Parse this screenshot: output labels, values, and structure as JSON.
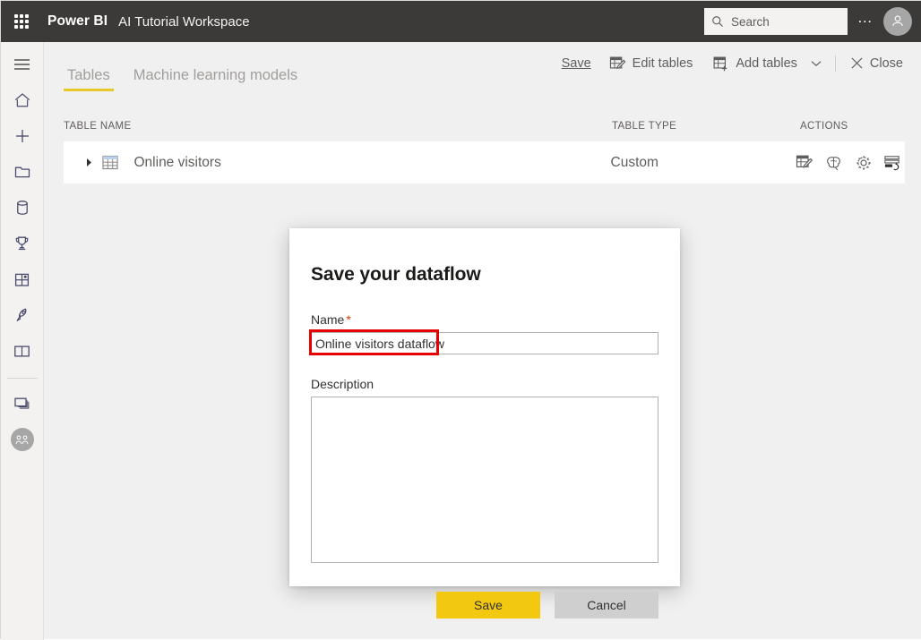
{
  "topbar": {
    "waffle_icon": "app-launcher-icon",
    "brand": "Power BI",
    "workspace": "AI Tutorial Workspace",
    "search": {
      "icon": "search-icon",
      "placeholder": "Search",
      "value": ""
    },
    "ellipsis": "…",
    "avatar_icon": "user-avatar-icon"
  },
  "rail": {
    "items": [
      {
        "icon": "hamburger-menu-icon",
        "name": "navigation-toggle"
      },
      {
        "icon": "home-icon",
        "name": "home"
      },
      {
        "icon": "plus-icon",
        "name": "create"
      },
      {
        "icon": "folder-icon",
        "name": "browse"
      },
      {
        "icon": "database-icon",
        "name": "datahub"
      },
      {
        "icon": "trophy-icon",
        "name": "metrics"
      },
      {
        "icon": "apps-grid-icon",
        "name": "apps"
      },
      {
        "icon": "rocket-icon",
        "name": "deployment-pipelines"
      },
      {
        "icon": "book-icon",
        "name": "learn"
      }
    ],
    "bottom_items": [
      {
        "icon": "workspaces-icon",
        "name": "workspaces"
      },
      {
        "icon": "workspace-avatar-icon",
        "name": "current-workspace"
      }
    ]
  },
  "cmdbar": {
    "tabs": [
      {
        "label": "Tables",
        "active": true
      },
      {
        "label": "Machine learning models",
        "active": false
      }
    ],
    "actions": {
      "save": "Save",
      "edit_tables": "Edit tables",
      "edit_tables_icon": "edit-table-icon",
      "add_tables": "Add tables",
      "add_tables_icon": "add-table-icon",
      "dropdown_icon": "chevron-down-icon",
      "close": "Close",
      "close_icon": "close-x-icon"
    }
  },
  "table": {
    "headers": {
      "name": "TABLE NAME",
      "type": "TABLE TYPE",
      "actions": "ACTIONS"
    },
    "rows": [
      {
        "expand_icon": "chevron-right-icon",
        "table_icon": "table-grid-icon",
        "name": "Online visitors",
        "type": "Custom",
        "actions": [
          {
            "icon": "edit-table-icon",
            "name": "edit-table-action"
          },
          {
            "icon": "ai-brain-icon",
            "name": "apply-ml-model-action"
          },
          {
            "icon": "gear-icon",
            "name": "table-settings-action"
          },
          {
            "icon": "incremental-refresh-icon",
            "name": "incremental-refresh-action"
          }
        ]
      }
    ]
  },
  "dialog": {
    "title": "Save your dataflow",
    "name_label": "Name",
    "required_marker": "*",
    "name_value": "Online visitors dataflow",
    "name_placeholder": "",
    "description_label": "Description",
    "description_value": "",
    "description_placeholder": "",
    "save_button": "Save",
    "cancel_button": "Cancel"
  },
  "colors": {
    "topbar_bg": "#3b3a39",
    "accent_yellow": "#f2c811",
    "tab_underline": "#e8c92a",
    "highlight_red": "#e60000",
    "required_red": "#d83b01",
    "page_bg": "#f0f0f0",
    "rail_bg": "#f3f2f1"
  }
}
